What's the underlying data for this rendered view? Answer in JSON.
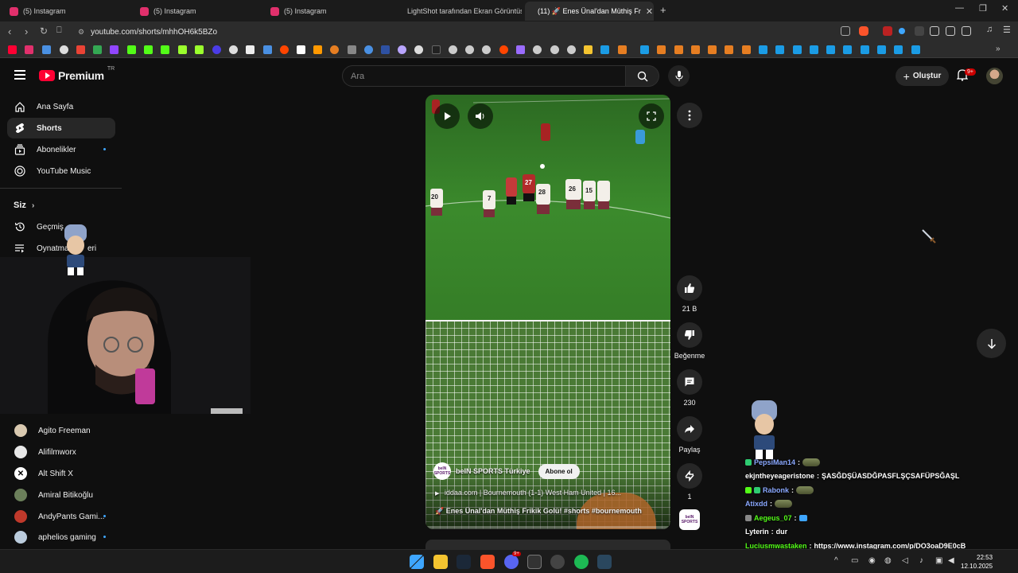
{
  "browser": {
    "tabs": [
      {
        "label": "(5) Instagram"
      },
      {
        "label": "(5) Instagram"
      },
      {
        "label": "(5) Instagram"
      },
      {
        "label": "LightShot tarafından Ekran Görüntüsü"
      },
      {
        "label": "(11) 🚀 Enes Ünal'dan Müthiş Fr"
      }
    ],
    "url": "youtube.com/shorts/mhhOH6k5BZo",
    "colors": {
      "youtube_red": "#ff0033",
      "instagram_pink": "#e1306c",
      "lightshot_purple": "#9b6cff"
    }
  },
  "header": {
    "logo_text": "Premium",
    "logo_region": "TR",
    "search_placeholder": "Ara",
    "create_label": "Oluştur",
    "notif_count": "9+"
  },
  "sidebar": {
    "items": [
      {
        "label": "Ana Sayfa",
        "icon": "home-icon"
      },
      {
        "label": "Shorts",
        "icon": "shorts-icon"
      },
      {
        "label": "Abonelikler",
        "icon": "subscriptions-icon"
      },
      {
        "label": "YouTube Music",
        "icon": "music-icon"
      }
    ],
    "you_section": "Siz",
    "you_items": [
      {
        "label": "Geçmiş",
        "icon": "history-icon"
      },
      {
        "label": "Oynatma listeleri",
        "visible_label": "Oynatma",
        "visible_tail": "eri",
        "icon": "playlist-icon"
      }
    ],
    "subscriptions": [
      {
        "label": "Agito Freeman",
        "dot": false
      },
      {
        "label": "Alifilmworx",
        "dot": false
      },
      {
        "label": "Alt Shift X",
        "dot": false
      },
      {
        "label": "Amiral Bitikoğlu",
        "dot": false
      },
      {
        "label": "AndyPants Gami...",
        "dot": true
      },
      {
        "label": "aphelios gaming",
        "dot": true
      }
    ]
  },
  "video": {
    "channel": "beIN SPORTS Türkiye",
    "channel_logo_text": "beIN SPORTS",
    "subscribe_label": "Abone ol",
    "line1": "iddaa.com | Bournemouth (1-1) West Ham United | 16...",
    "line2_prefix": "🚀 Enes Ünal'dan Müthiş Frikik Golü! ",
    "line2_tags": "#shorts #bournemouth",
    "jersey_numbers": [
      "20",
      "7",
      "27",
      "28",
      "26",
      "15"
    ]
  },
  "actions": {
    "likes": "21 B",
    "dislike": "Beğenme",
    "comments": "230",
    "share": "Paylaş",
    "remix": "1"
  },
  "chat": [
    {
      "user": "PepsiMan14",
      "sep": " :",
      "msg": "",
      "emote": true
    },
    {
      "user": "ekjntheyeageristone",
      "sep": " :",
      "msg": "ŞASĞDŞÜASDĞPASFLŞÇSAFÜPSĞAŞL",
      "emote": false,
      "white": true
    },
    {
      "user": "Rabonk",
      "sep": " :",
      "msg": "",
      "emote": true
    },
    {
      "user": "Atixdd",
      "sep": " :",
      "msg": "",
      "emote": true
    },
    {
      "user": "Aegeus_07",
      "sep": " :",
      "msg": "",
      "emote": true
    },
    {
      "user": "Lyterin",
      "sep": " :",
      "msg": "dur",
      "emote": false,
      "white": true
    },
    {
      "user": "Luciusmwastaken",
      "sep": " :",
      "msg": "https://www.instagram.com/p/DO3oaD9E0cB",
      "emote": false,
      "green": true
    }
  ],
  "taskbar": {
    "time": "22:53",
    "date": "12.10.2025",
    "discord_badge": "9+"
  }
}
